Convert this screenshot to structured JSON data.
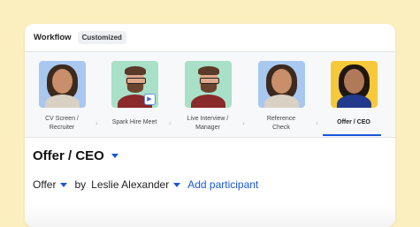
{
  "header": {
    "title": "Workflow",
    "badge": "Customized"
  },
  "steps": [
    {
      "label_line1": "CV Screen /",
      "label_line2": "Recruiter",
      "avatar": "woman-curly-hair"
    },
    {
      "label_line1": "Spark Hire Meet",
      "label_line2": "",
      "avatar": "man-glasses",
      "has_video_icon": true
    },
    {
      "label_line1": "Live Interview /",
      "label_line2": "Manager",
      "avatar": "man-glasses"
    },
    {
      "label_line1": "Reference",
      "label_line2": "Check",
      "avatar": "woman-curly-hair"
    },
    {
      "label_line1": "Offer / CEO",
      "label_line2": "",
      "avatar": "woman-long-hair",
      "active": true
    }
  ],
  "section": {
    "title": "Offer / CEO"
  },
  "participants": {
    "stage": "Offer",
    "by_text": "by",
    "person": "Leslie Alexander",
    "add_label": "Add participant"
  },
  "colors": {
    "accent": "#1a56d6",
    "background": "#fcefbf",
    "active_avatar_bg": "#f5c93a"
  }
}
